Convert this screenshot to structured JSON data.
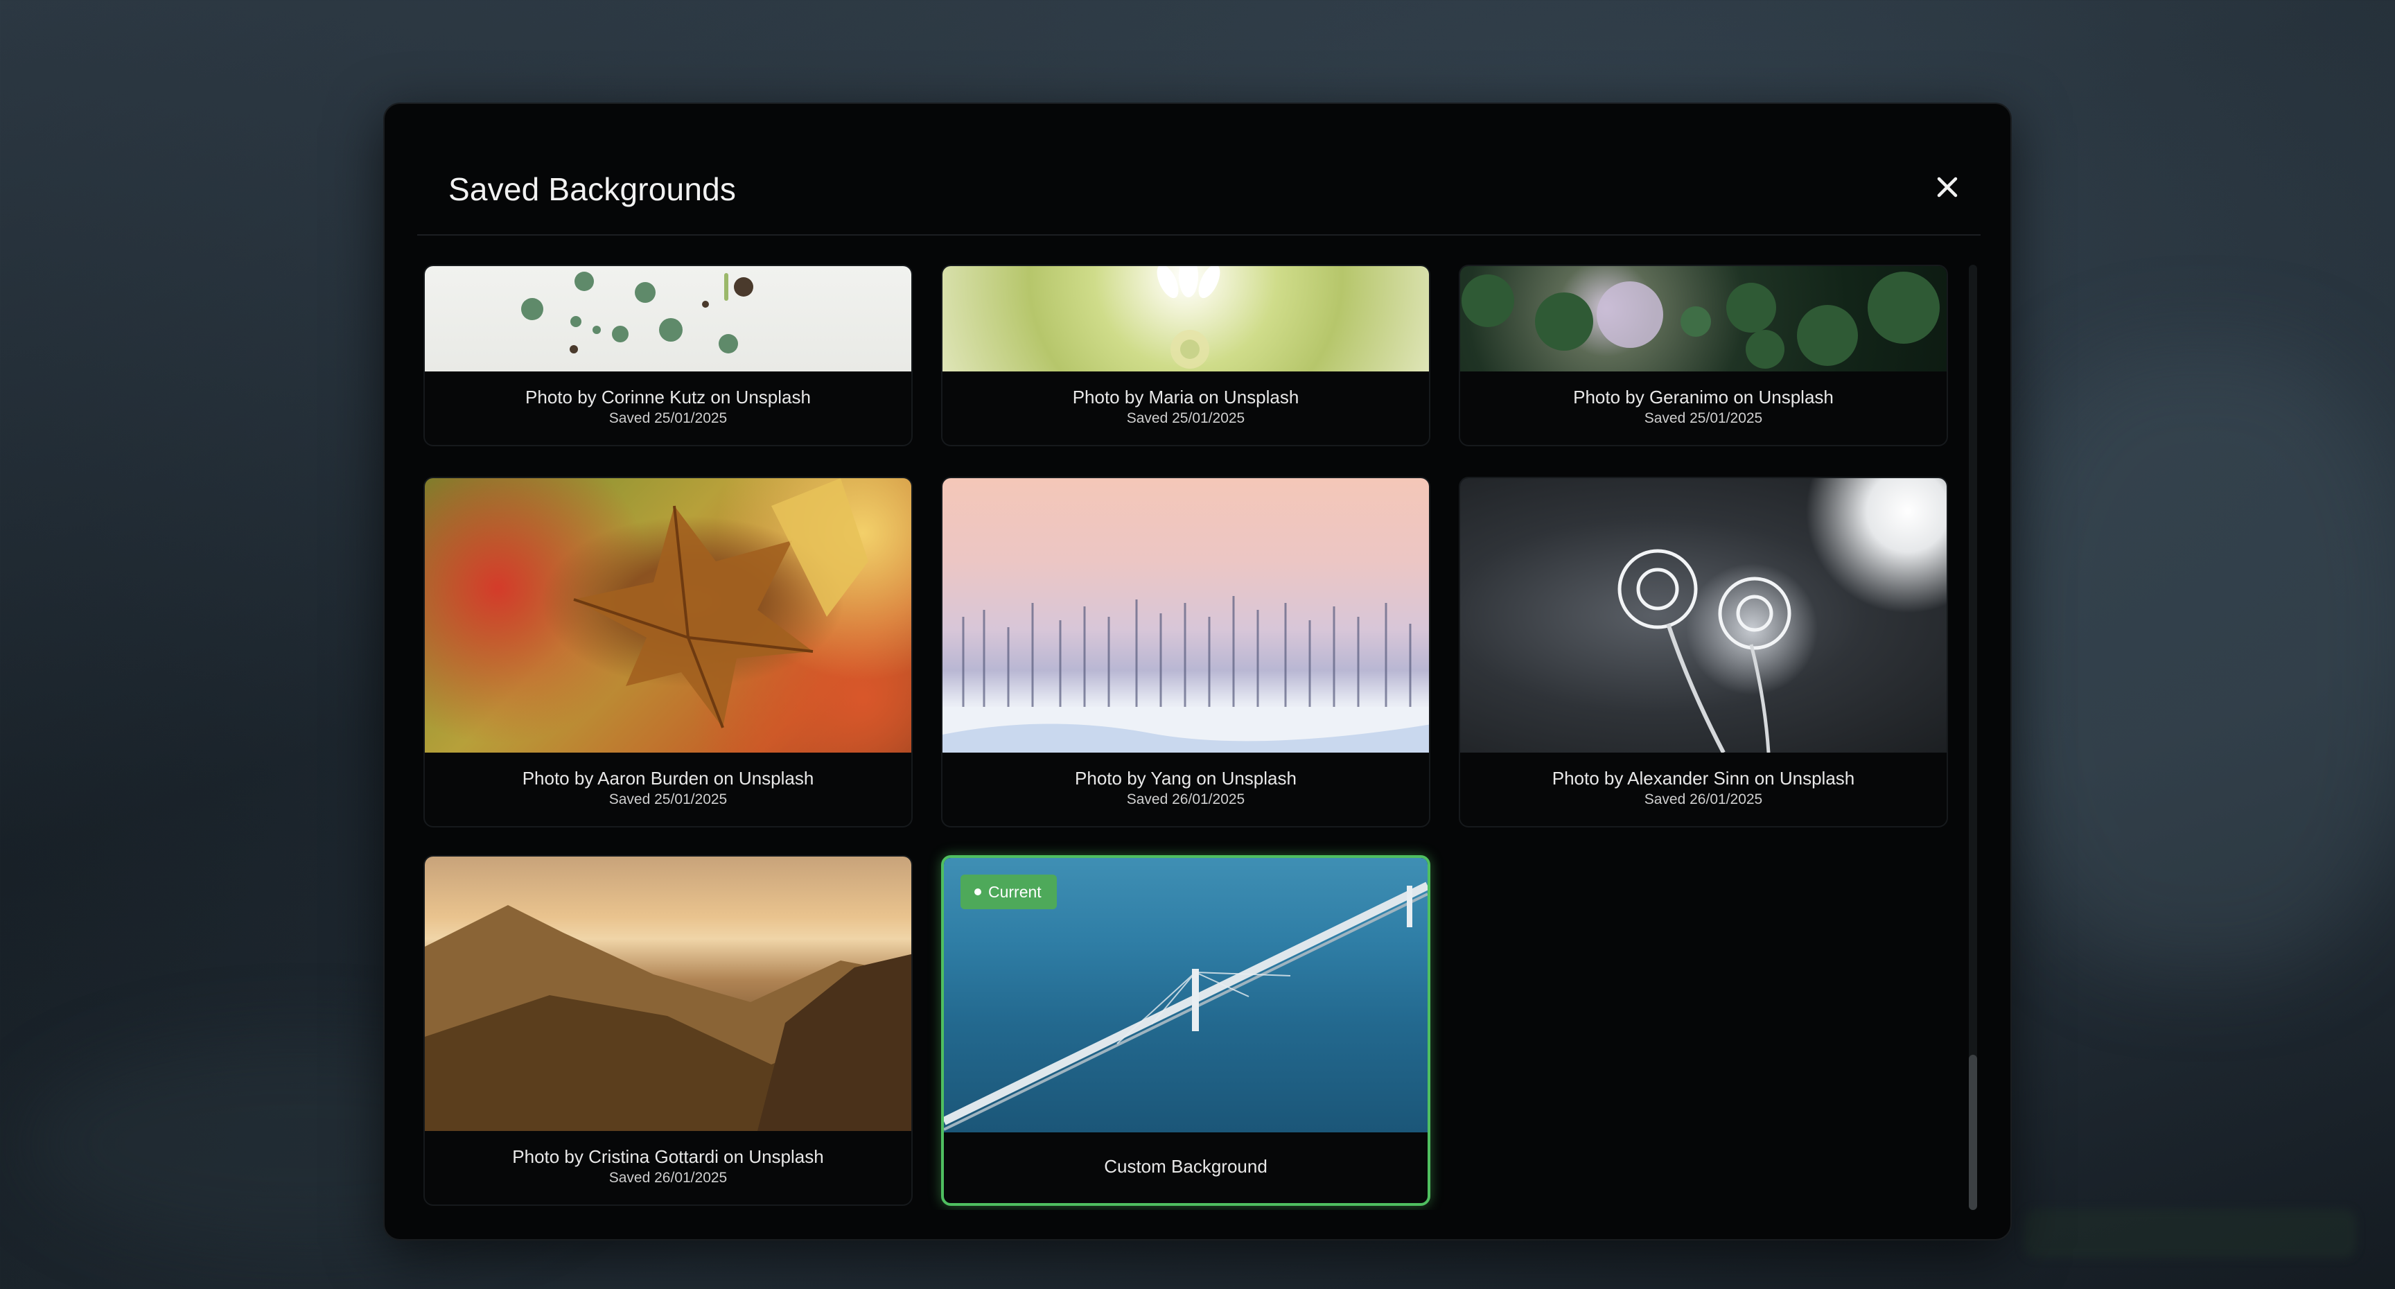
{
  "modal": {
    "title": "Saved Backgrounds",
    "close_icon": "close-icon"
  },
  "backgrounds": [
    {
      "title": "Photo by Corinne Kutz on Unsplash",
      "saved": "Saved 25/01/2025",
      "image": "succulents-photo"
    },
    {
      "title": "Photo by Maria on Unsplash",
      "saved": "Saved 25/01/2025",
      "image": "daisy-photo"
    },
    {
      "title": "Photo by Geranimo on Unsplash",
      "saved": "Saved 25/01/2025",
      "image": "forest-aerial-photo"
    },
    {
      "title": "Photo by Aaron Burden on Unsplash",
      "saved": "Saved 25/01/2025",
      "image": "autumn-leaf-photo"
    },
    {
      "title": "Photo by Yang on Unsplash",
      "saved": "Saved 26/01/2025",
      "image": "snowy-trees-photo"
    },
    {
      "title": "Photo by Alexander Sinn on Unsplash",
      "saved": "Saved 26/01/2025",
      "image": "frosted-plant-photo"
    },
    {
      "title": "Photo by Cristina Gottardi on Unsplash",
      "saved": "Saved 26/01/2025",
      "image": "mountain-sunset-photo"
    },
    {
      "title": "Custom Background",
      "image": "bridge-aerial-photo",
      "current": true,
      "badge": "Current"
    }
  ],
  "colors": {
    "accent": "#4fbf60",
    "badge": "#4ea95a",
    "modal_bg": "#050607"
  }
}
